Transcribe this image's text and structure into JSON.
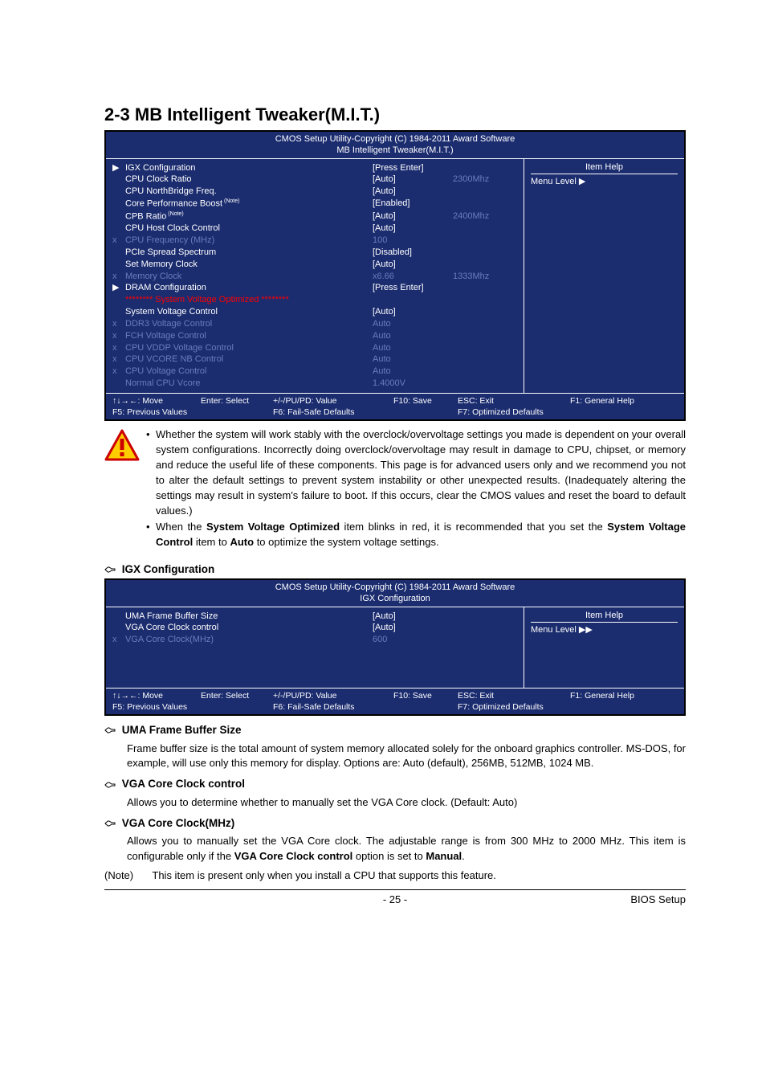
{
  "section_title": "2-3    MB Intelligent Tweaker(M.I.T.)",
  "bios1": {
    "header_l1": "CMOS Setup Utility-Copyright (C) 1984-2011 Award Software",
    "header_l2": "MB Intelligent Tweaker(M.I.T.)",
    "rows": [
      {
        "mark": "▶",
        "mark_arrow": true,
        "label": "IGX Configuration",
        "val": "[Press Enter]",
        "extra": ""
      },
      {
        "mark": "",
        "label": "CPU Clock Ratio",
        "val": "[Auto]",
        "extra": "2300Mhz"
      },
      {
        "mark": "",
        "label": "CPU NorthBridge Freq.",
        "val": "[Auto]",
        "extra": ""
      },
      {
        "mark": "",
        "label": "Core Performance Boost",
        "note": "(Note)",
        "val": "[Enabled]",
        "extra": ""
      },
      {
        "mark": "",
        "label": "   CPB Ratio",
        "note": "(Note)",
        "val": "[Auto]",
        "extra": "2400Mhz"
      },
      {
        "mark": "",
        "label": "CPU Host Clock Control",
        "val": "[Auto]",
        "extra": ""
      },
      {
        "mark": "x",
        "dim": true,
        "label": "CPU Frequency (MHz)",
        "val": "100",
        "valdim": true,
        "extra": ""
      },
      {
        "mark": "",
        "label": "PCIe Spread Spectrum",
        "val": "[Disabled]",
        "extra": ""
      },
      {
        "mark": "",
        "label": "Set Memory Clock",
        "val": "[Auto]",
        "extra": ""
      },
      {
        "mark": "x",
        "dim": true,
        "label": "Memory Clock",
        "val": "x6.66",
        "valdim": true,
        "extra": "1333Mhz"
      },
      {
        "mark": "▶",
        "mark_arrow": true,
        "label": "DRAM Configuration",
        "val": "[Press Enter]",
        "extra": ""
      }
    ],
    "svo": "********   System Voltage Optimized   ********",
    "rows2": [
      {
        "mark": "",
        "label": "System Voltage Control",
        "val": "[Auto]",
        "extra": ""
      },
      {
        "mark": "x",
        "dim": true,
        "label": "DDR3 Voltage Control",
        "val": "Auto",
        "valdim": true,
        "extra": ""
      },
      {
        "mark": "x",
        "dim": true,
        "label": "FCH Voltage Control",
        "val": "Auto",
        "valdim": true,
        "extra": ""
      },
      {
        "mark": "x",
        "dim": true,
        "label": "CPU VDDP Voltage Control",
        "val": "Auto",
        "valdim": true,
        "extra": ""
      },
      {
        "mark": "x",
        "dim": true,
        "label": "CPU VCORE NB Control",
        "val": "Auto",
        "valdim": true,
        "extra": ""
      },
      {
        "mark": "x",
        "dim": true,
        "label": "CPU Voltage Control",
        "val": "Auto",
        "valdim": true,
        "extra": ""
      },
      {
        "mark": "",
        "dim": true,
        "label": "Normal CPU Vcore",
        "val": "1.4000V",
        "valdim": true,
        "extra": ""
      }
    ],
    "help_title": "Item Help",
    "menu_level": "Menu Level   ▶",
    "footer": {
      "c1a": "↑↓→←: Move",
      "c1b": "F5: Previous Values",
      "c2a": "Enter: Select",
      "c2b": "",
      "c3a": "+/-/PU/PD: Value",
      "c3b": "F6: Fail-Safe Defaults",
      "c4a": "F10: Save",
      "c4b": "",
      "c5a": "ESC: Exit",
      "c5b": "F7: Optimized Defaults",
      "c6a": "F1: General Help",
      "c6b": ""
    }
  },
  "warning": {
    "bullet1": "Whether the system will work stably with the overclock/overvoltage settings you made is dependent on your overall system configurations. Incorrectly doing overclock/overvoltage may result in damage to CPU, chipset, or memory and reduce the useful life of these components. This page is for advanced users only and we recommend you not to alter the default settings to prevent system instability or other unexpected results. (Inadequately altering the settings may result in system's failure to boot. If this occurs, clear the CMOS values and reset the board to default values.)",
    "bullet2_pre": "When the ",
    "bullet2_b1": "System Voltage Optimized",
    "bullet2_mid": " item blinks in red, it is recommended that you set the ",
    "bullet2_b2": "System Voltage Control",
    "bullet2_mid2": " item to ",
    "bullet2_b3": "Auto",
    "bullet2_post": " to optimize the system voltage settings."
  },
  "igx_heading": "IGX Configuration",
  "bios2": {
    "header_l1": "CMOS Setup Utility-Copyright (C) 1984-2011 Award Software",
    "header_l2": "IGX Configuration",
    "rows": [
      {
        "mark": "",
        "label": "UMA Frame Buffer Size",
        "val": "[Auto]",
        "extra": ""
      },
      {
        "mark": "",
        "label": "VGA Core Clock control",
        "val": "[Auto]",
        "extra": ""
      },
      {
        "mark": "x",
        "dim": true,
        "label": "VGA Core Clock(MHz)",
        "val": "600",
        "valdim": true,
        "extra": ""
      }
    ],
    "help_title": "Item Help",
    "menu_level": "Menu Level   ▶▶",
    "footer": {
      "c1a": "↑↓→←: Move",
      "c1b": "F5: Previous Values",
      "c2a": "Enter: Select",
      "c2b": "",
      "c3a": "+/-/PU/PD: Value",
      "c3b": "F6: Fail-Safe Defaults",
      "c4a": "F10: Save",
      "c4b": "",
      "c5a": "ESC: Exit",
      "c5b": "F7: Optimized Defaults",
      "c6a": "F1: General Help",
      "c6b": ""
    }
  },
  "desc": {
    "uma_h": "UMA Frame Buffer Size",
    "uma_b": "Frame buffer size is the total amount of system memory allocated solely for the onboard graphics controller. MS-DOS, for example, will use only this memory for display. Options are: Auto (default), 256MB, 512MB, 1024 MB.",
    "vcc_h": "VGA Core Clock control",
    "vcc_b": "Allows you to determine whether to manually set the VGA Core clock. (Default: Auto)",
    "vcm_h": "VGA Core Clock(MHz)",
    "vcm_b_pre": "Allows you to manually set the VGA Core clock. The adjustable range is from 300 MHz to 2000 MHz. This item is configurable only if the ",
    "vcm_b_b1": "VGA Core Clock control",
    "vcm_b_mid": " option is set to ",
    "vcm_b_b2": "Manual",
    "vcm_b_post": "."
  },
  "note": {
    "label": "(Note)",
    "text": "This item is present only when you install a CPU that supports this feature."
  },
  "footer": {
    "page": "- 25 -",
    "right": "BIOS Setup"
  }
}
